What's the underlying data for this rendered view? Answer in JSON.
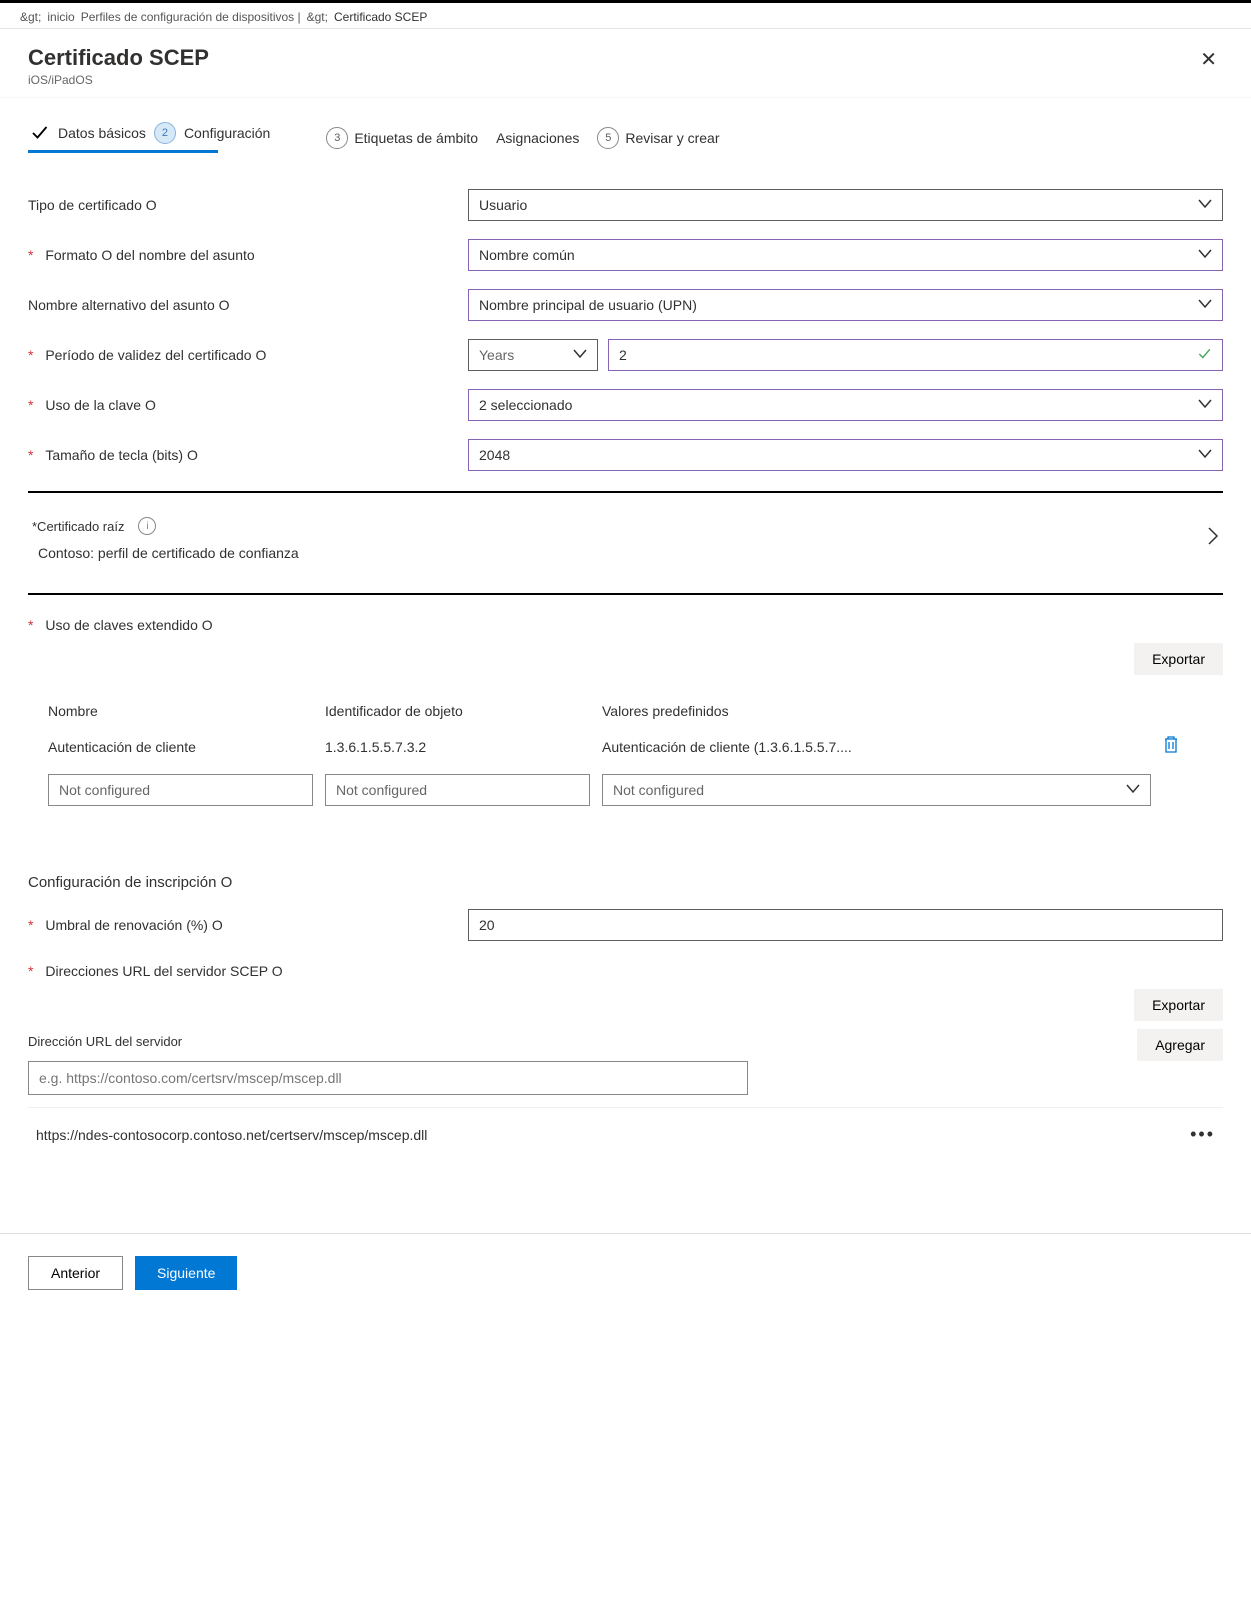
{
  "breadcrumb": {
    "sep": "&gt;",
    "home": "inicio",
    "profiles": "Perfiles de configuración de dispositivos |",
    "sep2": "&gt;",
    "current": "Certificado SCEP"
  },
  "header": {
    "title": "Certificado SCEP",
    "subtitle": "iOS/iPadOS"
  },
  "steps": {
    "s1": "Datos básicos",
    "s2": "Configuración",
    "s2_num": "2",
    "s3_num": "3",
    "s3a": "Etiquetas de ámbito",
    "s3b": "Asignaciones",
    "s5_num": "5",
    "s5": "Revisar y crear"
  },
  "fields": {
    "cert_type_label": "Tipo de certificado O",
    "cert_type_value": "Usuario",
    "subj_fmt_label": "Formato O del nombre del asunto",
    "subj_fmt_value": "Nombre común",
    "san_label": "Nombre alternativo del asunto O",
    "san_value": "Nombre principal de usuario (UPN)",
    "valid_label": "Período de validez del certificado O",
    "valid_unit": "Years",
    "valid_value": "2",
    "key_usage_label": "Uso de la clave O",
    "key_usage_value": "2 seleccionado",
    "key_size_label": "Tamaño de tecla (bits) O",
    "key_size_value": "2048"
  },
  "rootcert": {
    "label": "*Certificado raíz",
    "value": "Contoso: perfil de certificado de confianza"
  },
  "eku": {
    "title": "Uso de claves extendido O",
    "export": "Exportar",
    "col_name": "Nombre",
    "col_oid": "Identificador de objeto",
    "col_preset": "Valores predefinidos",
    "row_name": "Autenticación de cliente",
    "row_oid": "1.3.6.1.5.5.7.3.2",
    "row_preset": "Autenticación de cliente (1.3.6.1.5.5.7....",
    "placeholder": "Not configured"
  },
  "enroll": {
    "title": "Configuración de inscripción O",
    "thresh_label": "Umbral de renovación (%) O",
    "thresh_value": "20",
    "url_label": "Direcciones URL del servidor SCEP O",
    "export": "Exportar",
    "add": "Agregar",
    "server_url_label": "Dirección URL del servidor",
    "server_url_placeholder": "e.g. https://contoso.com/certsrv/mscep/mscep.dll",
    "url_row": "https://ndes-contosocorp.contoso.net/certserv/mscep/mscep.dll"
  },
  "footer": {
    "prev": "Anterior",
    "next": "Siguiente"
  }
}
